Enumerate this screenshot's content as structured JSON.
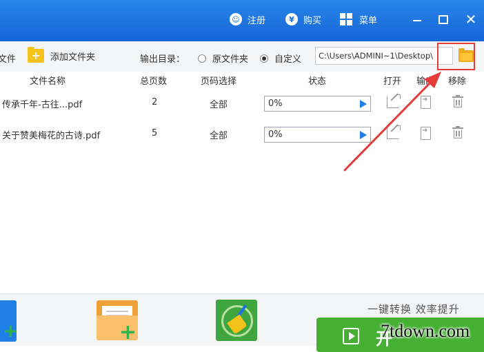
{
  "titlebar": {
    "register_label": "注册",
    "buy_label": "购买",
    "menu_label": "菜单",
    "register_icon": "user-icon",
    "buy_icon": "yen-icon",
    "menu_icon": "grid-icon",
    "close_glyph": "✕"
  },
  "toolbar": {
    "file_label": "文件",
    "add_folder_label": "添加文件夹",
    "output_dir_label": "输出目录：",
    "radio_original": "原文件夹",
    "radio_custom": "自定义",
    "selected_radio": "自定义",
    "path_value": "C:\\Users\\ADMINI~1\\Desktop\\"
  },
  "table": {
    "columns": [
      "文件名称",
      "总页数",
      "页码选择",
      "状态",
      "打开",
      "输出",
      "移除"
    ],
    "rows": [
      {
        "name": "传承千年-古往...pdf",
        "pages": "2",
        "range": "全部",
        "progress": "0%"
      },
      {
        "name": "关于赞美梅花的古诗.pdf",
        "pages": "5",
        "range": "全部",
        "progress": "0%"
      }
    ]
  },
  "bottom": {
    "slogan": "一键转换  效率提升",
    "start_label": "开",
    "watermark": "7tdown.com"
  },
  "colors": {
    "titlebar": "#1a72e0",
    "accent_green": "#46b034",
    "highlight_red": "#e53b3b"
  }
}
